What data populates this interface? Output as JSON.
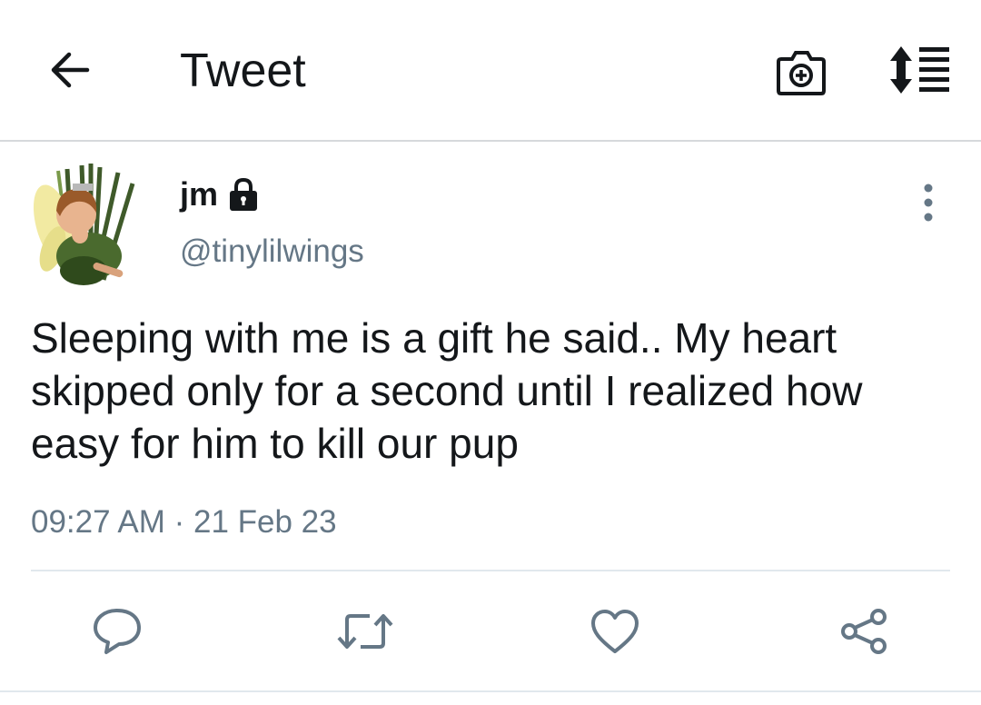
{
  "header": {
    "title": "Tweet",
    "back_icon": "arrow-left-icon",
    "camera_icon": "camera-plus-icon",
    "sort_icon": "sort-list-icon"
  },
  "tweet": {
    "display_name": "jm",
    "protected_icon": "lock-icon",
    "handle": "@tinylilwings",
    "text": "Sleeping with me is a gift he said.. My heart skipped only for a second until I realized how easy for him to kill our pup",
    "timestamp": "09:27 AM · 21 Feb 23",
    "more_icon": "vertical-dots-icon"
  },
  "actions": {
    "reply_icon": "reply-bubble-icon",
    "retweet_icon": "retweet-icon",
    "like_icon": "heart-icon",
    "share_icon": "share-icon"
  },
  "colors": {
    "text_primary": "#14171a",
    "text_secondary": "#657786",
    "icon_gray": "#657786",
    "divider": "#e1e8ed"
  }
}
